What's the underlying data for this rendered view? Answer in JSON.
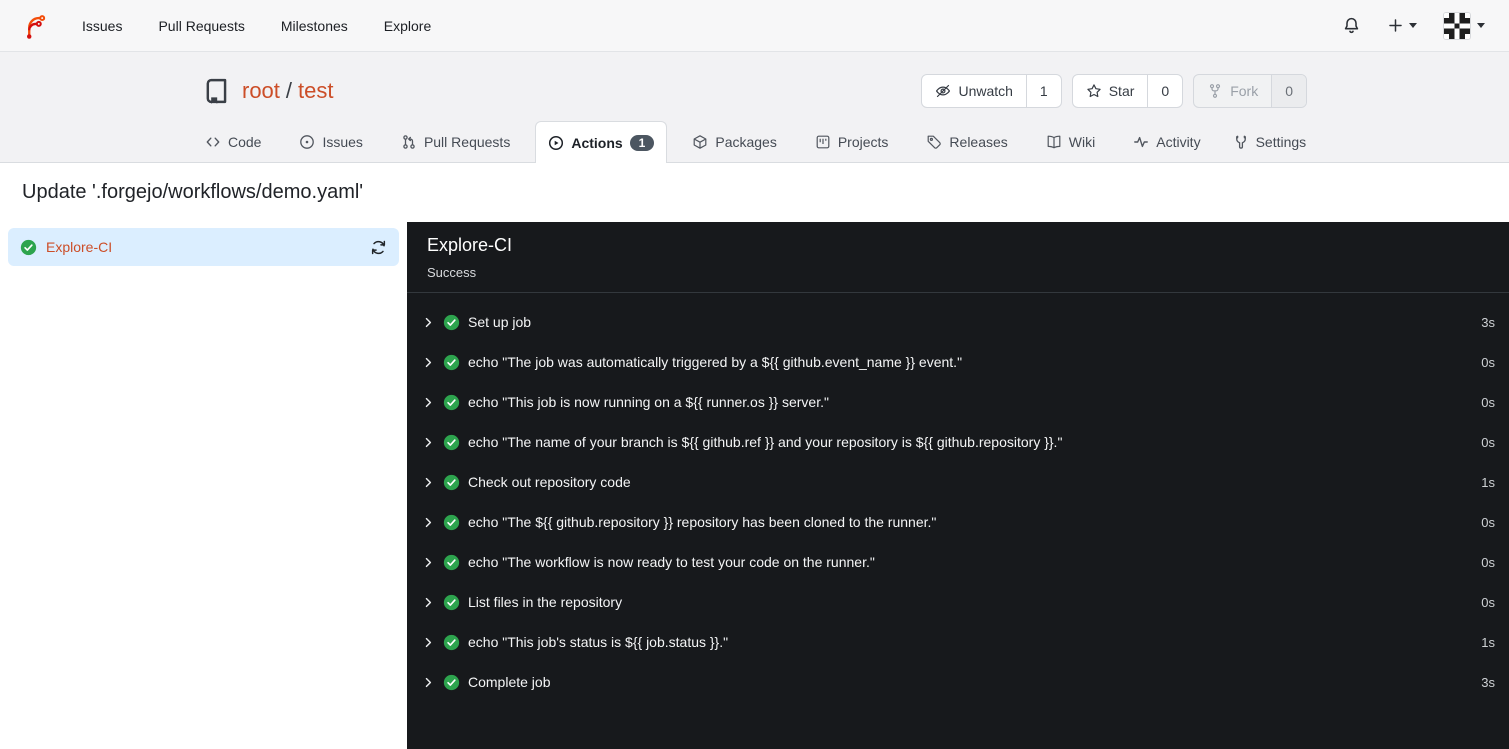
{
  "navbar": {
    "logo": "forgejo-logo",
    "items": [
      {
        "label": "Issues"
      },
      {
        "label": "Pull Requests"
      },
      {
        "label": "Milestones"
      },
      {
        "label": "Explore"
      }
    ],
    "right": {
      "bell": "notifications",
      "plus": "+",
      "avatar": "user-identicon"
    }
  },
  "repo_header": {
    "owner": "root",
    "separator": "/",
    "name": "test",
    "buttons": [
      {
        "label": "Unwatch",
        "count": "1",
        "icon": "eye-off",
        "disabled": false
      },
      {
        "label": "Star",
        "count": "0",
        "icon": "star",
        "disabled": false
      },
      {
        "label": "Fork",
        "count": "0",
        "icon": "git-fork",
        "disabled": true
      }
    ]
  },
  "tabs": [
    {
      "label": "Code",
      "icon": "code"
    },
    {
      "label": "Issues",
      "icon": "issue-circle"
    },
    {
      "label": "Pull Requests",
      "icon": "git-pull-request"
    },
    {
      "label": "Actions",
      "icon": "play-circle",
      "badge": "1",
      "active": true
    },
    {
      "label": "Packages",
      "icon": "package"
    },
    {
      "label": "Projects",
      "icon": "project-board"
    },
    {
      "label": "Releases",
      "icon": "tag"
    },
    {
      "label": "Wiki",
      "icon": "book-open"
    },
    {
      "label": "Activity",
      "icon": "pulse"
    },
    {
      "label": "Settings",
      "icon": "tools"
    }
  ],
  "page": {
    "title": "Update '.forgejo/workflows/demo.yaml'"
  },
  "sidebar": {
    "runs": [
      {
        "label": "Explore-CI",
        "status": "success"
      }
    ]
  },
  "job_panel": {
    "title": "Explore-CI",
    "status": "Success",
    "steps": [
      {
        "label": "Set up job",
        "duration": "3s",
        "status": "success"
      },
      {
        "label": "echo \"The job was automatically triggered by a ${{ github.event_name }} event.\"",
        "duration": "0s",
        "status": "success"
      },
      {
        "label": "echo \"This job is now running on a ${{ runner.os }} server.\"",
        "duration": "0s",
        "status": "success"
      },
      {
        "label": "echo \"The name of your branch is ${{ github.ref }} and your repository is ${{ github.repository }}.\"",
        "duration": "0s",
        "status": "success"
      },
      {
        "label": "Check out repository code",
        "duration": "1s",
        "status": "success"
      },
      {
        "label": "echo \"The ${{ github.repository }} repository has been cloned to the runner.\"",
        "duration": "0s",
        "status": "success"
      },
      {
        "label": "echo \"The workflow is now ready to test your code on the runner.\"",
        "duration": "0s",
        "status": "success"
      },
      {
        "label": "List files in the repository",
        "duration": "0s",
        "status": "success"
      },
      {
        "label": "echo \"This job's status is ${{ job.status }}.\"",
        "duration": "1s",
        "status": "success"
      },
      {
        "label": "Complete job",
        "duration": "3s",
        "status": "success"
      }
    ]
  },
  "colors": {
    "accent_link": "#cc4e28",
    "success_green": "#2da44e",
    "panel_dark_bg": "#17191c",
    "selected_run_bg": "#dbeeff",
    "header_bg": "#f2f2f4",
    "navbar_bg": "#f7f7f8",
    "badge_bg": "#4c5661"
  }
}
